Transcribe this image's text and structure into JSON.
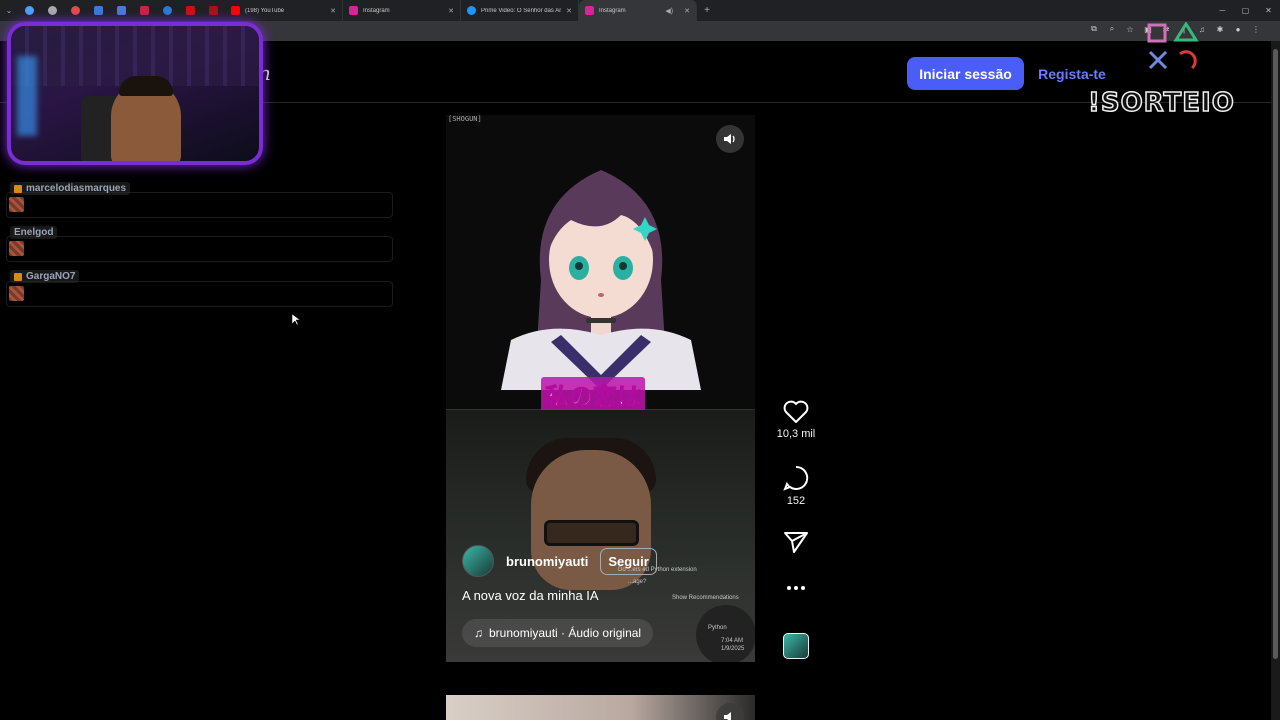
{
  "browser": {
    "tabs": [
      {
        "title": "(198) YouTube",
        "favicon_color": "#ff0000"
      },
      {
        "title": "Instagram",
        "favicon_color": "#d6249f"
      },
      {
        "title": "Prime Video: O Senhor das An",
        "favicon_color": "#1a98ff"
      },
      {
        "title": "Instagram",
        "favicon_color": "#d6249f",
        "active": true
      }
    ],
    "pinned_colors": [
      "#4aa3ff",
      "#aaaaaa",
      "#e34b4b",
      "#3a7bd5",
      "#4a7bd5",
      "#cc2244",
      "#2a7bd5",
      "#cc1111",
      "#aa1111"
    ]
  },
  "header": {
    "logo_fragment": "n",
    "login_label": "Iniciar sessão",
    "signup_label": "Regista-te"
  },
  "overlay": {
    "sorteio_text": "!SORTEIO"
  },
  "chat": {
    "items": [
      {
        "name": "marcelodiasmarques"
      },
      {
        "name": "Enelgod"
      },
      {
        "name": "GargaNO7"
      }
    ]
  },
  "reel": {
    "watermark": "[SHOGUN]",
    "subtitle": "私の恋は",
    "author": "brunomiyauti",
    "follow_label": "Seguir",
    "caption": "A nova voz da minha IA",
    "audio": "brunomiyauti · Áudio original",
    "popup_lines": [
      "Do ...ers ed Python extension",
      "...age?",
      "Show Recommendations",
      "Python",
      "7:04 AM",
      "1/9/2025"
    ]
  },
  "actions": {
    "likes": "10,3 mil",
    "comments": "152"
  },
  "colors": {
    "accent": "#4a5df9",
    "link": "#6b7cff",
    "cam_border": "#7a2cd6"
  }
}
